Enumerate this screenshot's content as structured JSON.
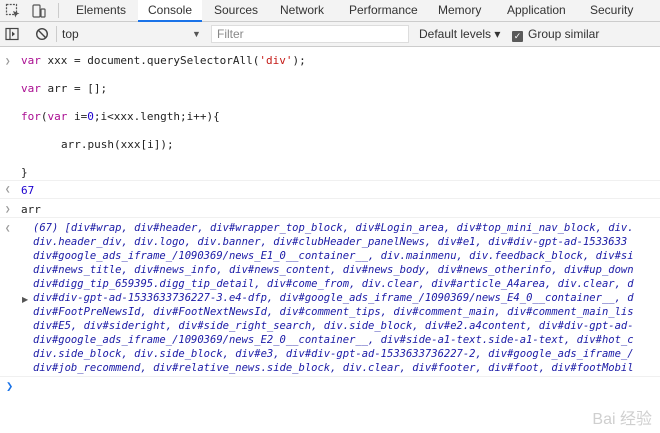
{
  "tabs": [
    {
      "label": "Elements"
    },
    {
      "label": "Console"
    },
    {
      "label": "Sources"
    },
    {
      "label": "Network"
    },
    {
      "label": "Performance"
    },
    {
      "label": "Memory"
    },
    {
      "label": "Application"
    },
    {
      "label": "Security"
    }
  ],
  "toolbar": {
    "context": "top",
    "filter_placeholder": "Filter",
    "levels": "Default levels ▾",
    "group_similar": "Group similar"
  },
  "code": {
    "line1_a": "var",
    "line1_b": " xxx = document.querySelectorAll(",
    "line1_c": "'div'",
    "line1_d": ");",
    "line2_a": "var",
    "line2_b": " arr = [];",
    "line3_a": "for",
    "line3_b": "(",
    "line3_c": "var",
    "line3_d": " i=",
    "line3_e": "0",
    "line3_f": ";i<xxx.length;i++){",
    "line4": "arr.push(xxx[i]);",
    "line5": "}"
  },
  "result1": "67",
  "input2": "arr",
  "output": [
    "(67) [div#wrap, div#header, div#wrapper_top_block, div#Login_area, div#top_mini_nav_block, div.",
    "div.header_div, div.logo, div.banner, div#clubHeader_panelNews, div#e1, div#div-gpt-ad-1533633",
    "div#google_ads_iframe_/1090369/news_E1_0__container__, div.mainmenu, div.feedback_block, div#si",
    "div#news_title, div#news_info, div#news_content, div#news_body, div#news_otherinfo, div#up_down",
    "div#digg_tip_659395.digg_tip_detail, div#come_from, div.clear, div#article_A4area, div.clear, d",
    "div#div-gpt-ad-1533633736227-3.e4-dfp, div#google_ads_iframe_/1090369/news_E4_0__container__, d",
    "div#FootPreNewsId, div#FootNextNewsId, div#comment_tips, div#comment_main, div#comment_main_lis",
    "div#E5, div#sideright, div#side_right_search, div.side_block, div#e2.a4content, div#div-gpt-ad-",
    "div#google_ads_iframe_/1090369/news_E2_0__container__, div#side-a1-text.side-a1-text, div#hot_c",
    "div.side_block, div.side_block, div#e3, div#div-gpt-ad-1533633736227-2, div#google_ads_iframe_/",
    "div#job_recommend, div#relative_news.side_block, div.clear, div#footer, div#foot, div#footMobil"
  ],
  "watermark": "Bai 经验"
}
